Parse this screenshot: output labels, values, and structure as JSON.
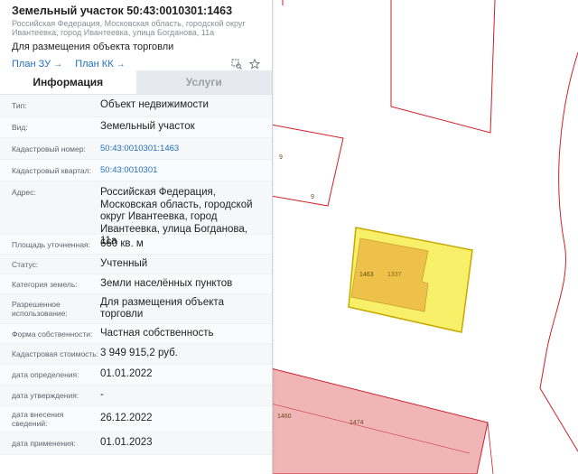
{
  "header": {
    "title": "Земельный участок 50:43:0010301:1463",
    "sub_address": "Российская Федерация, Московская область, городской округ Ивантеевка, город Ивантеевка, улица Богданова, 11а",
    "purpose": "Для размещения объекта торговли",
    "link_plan_zu": "План ЗУ",
    "link_plan_kk": "План КК",
    "icons": [
      "zoom-to-object-icon",
      "favorite-star-icon"
    ]
  },
  "tabs": [
    {
      "label": "Информация",
      "active": true
    },
    {
      "label": "Услуги",
      "active": false
    }
  ],
  "rows": [
    {
      "label": "Тип:",
      "value": "Объект недвижимости"
    },
    {
      "label": "Вид:",
      "value": "Земельный участок"
    },
    {
      "label": "Кадастровый номер:",
      "value": "50:43:0010301:1463",
      "link": true
    },
    {
      "label": "Кадастровый квартал:",
      "value": "50:43:0010301",
      "link": true
    },
    {
      "label": "Адрес:",
      "value": "Российская Федерация, Московская область, городской округ Ивантеевка, город Ивантеевка, улица Богданова, 11а"
    },
    {
      "label": "Площадь уточненная:",
      "value": "660 кв. м"
    },
    {
      "label": "Статус:",
      "value": "Учтенный"
    },
    {
      "label": "Категория земель:",
      "value": "Земли населённых пунктов"
    },
    {
      "label": "Разрешенное использование:",
      "value": "Для размещения объекта торговли"
    },
    {
      "label": "Форма собственности:",
      "value": "Частная собственность"
    },
    {
      "label": "Кадастровая стоимость:",
      "value": "3 949 915,2 руб."
    },
    {
      "label": "дата определения:",
      "value": "01.01.2022"
    },
    {
      "label": "дата утверждения:",
      "value": "-"
    },
    {
      "label": "дата внесения сведений:",
      "value": "26.12.2022"
    },
    {
      "label": "дата применения:",
      "value": "01.01.2023"
    }
  ],
  "map": {
    "labels": [
      "9",
      "9",
      "1463",
      "1337",
      "1460",
      "1474"
    ],
    "colors": {
      "boundary": "#d21f2b",
      "selected_fill": "#f9f06a",
      "selected_stroke": "#c9a800",
      "building_fill": "#eec24a",
      "pink_fill": "#f0b6b6"
    }
  }
}
